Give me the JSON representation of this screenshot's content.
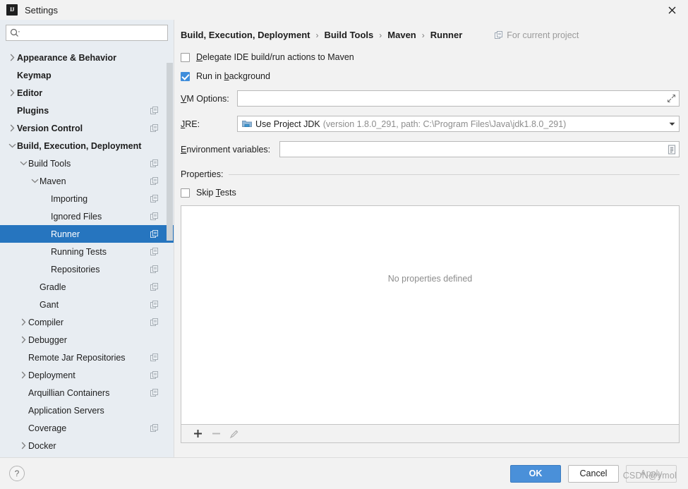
{
  "window": {
    "title": "Settings",
    "logo_icon": "intellij-idea-logo",
    "close_icon": "close-icon"
  },
  "search": {
    "value": "",
    "placeholder": "",
    "icon": "search-icon"
  },
  "sidebar": {
    "scrollbar": "vertical-scrollbar",
    "items": [
      {
        "label": "Appearance & Behavior",
        "indent": 0,
        "arrow": "collapsed",
        "bold": true,
        "copy": false,
        "selected": false
      },
      {
        "label": "Keymap",
        "indent": 0,
        "arrow": "none",
        "bold": true,
        "copy": false,
        "selected": false
      },
      {
        "label": "Editor",
        "indent": 0,
        "arrow": "collapsed",
        "bold": true,
        "copy": false,
        "selected": false
      },
      {
        "label": "Plugins",
        "indent": 0,
        "arrow": "none",
        "bold": true,
        "copy": true,
        "selected": false
      },
      {
        "label": "Version Control",
        "indent": 0,
        "arrow": "collapsed",
        "bold": true,
        "copy": true,
        "selected": false
      },
      {
        "label": "Build, Execution, Deployment",
        "indent": 0,
        "arrow": "expanded",
        "bold": true,
        "copy": false,
        "selected": false
      },
      {
        "label": "Build Tools",
        "indent": 1,
        "arrow": "expanded",
        "bold": false,
        "copy": true,
        "selected": false
      },
      {
        "label": "Maven",
        "indent": 2,
        "arrow": "expanded",
        "bold": false,
        "copy": true,
        "selected": false
      },
      {
        "label": "Importing",
        "indent": 3,
        "arrow": "none",
        "bold": false,
        "copy": true,
        "selected": false
      },
      {
        "label": "Ignored Files",
        "indent": 3,
        "arrow": "none",
        "bold": false,
        "copy": true,
        "selected": false
      },
      {
        "label": "Runner",
        "indent": 3,
        "arrow": "none",
        "bold": false,
        "copy": true,
        "selected": true
      },
      {
        "label": "Running Tests",
        "indent": 3,
        "arrow": "none",
        "bold": false,
        "copy": true,
        "selected": false
      },
      {
        "label": "Repositories",
        "indent": 3,
        "arrow": "none",
        "bold": false,
        "copy": true,
        "selected": false
      },
      {
        "label": "Gradle",
        "indent": 2,
        "arrow": "none",
        "bold": false,
        "copy": true,
        "selected": false
      },
      {
        "label": "Gant",
        "indent": 2,
        "arrow": "none",
        "bold": false,
        "copy": true,
        "selected": false
      },
      {
        "label": "Compiler",
        "indent": 1,
        "arrow": "collapsed",
        "bold": false,
        "copy": true,
        "selected": false
      },
      {
        "label": "Debugger",
        "indent": 1,
        "arrow": "collapsed",
        "bold": false,
        "copy": false,
        "selected": false
      },
      {
        "label": "Remote Jar Repositories",
        "indent": 1,
        "arrow": "none",
        "bold": false,
        "copy": true,
        "selected": false
      },
      {
        "label": "Deployment",
        "indent": 1,
        "arrow": "collapsed",
        "bold": false,
        "copy": true,
        "selected": false
      },
      {
        "label": "Arquillian Containers",
        "indent": 1,
        "arrow": "none",
        "bold": false,
        "copy": true,
        "selected": false
      },
      {
        "label": "Application Servers",
        "indent": 1,
        "arrow": "none",
        "bold": false,
        "copy": false,
        "selected": false
      },
      {
        "label": "Coverage",
        "indent": 1,
        "arrow": "none",
        "bold": false,
        "copy": true,
        "selected": false
      },
      {
        "label": "Docker",
        "indent": 1,
        "arrow": "collapsed",
        "bold": false,
        "copy": false,
        "selected": false
      }
    ]
  },
  "main": {
    "breadcrumb": [
      "Build, Execution, Deployment",
      "Build Tools",
      "Maven",
      "Runner"
    ],
    "breadcrumb_separator": "›",
    "for_current_project": {
      "label": "For current project",
      "icon": "module-scope-icon"
    },
    "delegate": {
      "label_pre": "",
      "mnemonic": "D",
      "label_post": "elegate IDE build/run actions to Maven",
      "checked": false
    },
    "run_background": {
      "label_pre": "Run in ",
      "mnemonic": "b",
      "label_post": "ackground",
      "checked": true
    },
    "vm_options": {
      "mnemonic": "V",
      "label_post": "M Options:",
      "value": "",
      "expand_icon": "expand-icon"
    },
    "jre": {
      "mnemonic": "J",
      "label_post": "RE:",
      "selected_main": "Use Project JDK",
      "selected_detail": "(version 1.8.0_291, path: C:\\Program Files\\Java\\jdk1.8.0_291)",
      "icon": "module-folder-icon",
      "arrow_icon": "chevron-down-icon"
    },
    "env_vars": {
      "mnemonic": "E",
      "label_post": "nvironment variables:",
      "value": "",
      "browse_icon": "list-edit-icon"
    },
    "properties_section": {
      "title": "Properties:"
    },
    "skip_tests": {
      "label_pre": "Skip ",
      "mnemonic": "T",
      "label_post": "ests",
      "checked": false
    },
    "properties_panel": {
      "empty_text": "No properties defined",
      "toolbar": [
        {
          "name": "add-property-button",
          "icon": "plus-icon",
          "enabled": true
        },
        {
          "name": "remove-property-button",
          "icon": "minus-icon",
          "enabled": false
        },
        {
          "name": "edit-property-button",
          "icon": "pencil-icon",
          "enabled": false
        }
      ]
    }
  },
  "footer": {
    "help_label": "?",
    "ok_label": "OK",
    "cancel_label": "Cancel",
    "apply_label": "Apply",
    "watermark": "CSDN@ymol"
  },
  "colors": {
    "accent": "#2675bf",
    "primary_button": "#4a90d9",
    "sidebar_bg": "#e8edf2",
    "panel_bg": "#f2f2f2",
    "checkbox_checked": "#3f8ddb"
  }
}
